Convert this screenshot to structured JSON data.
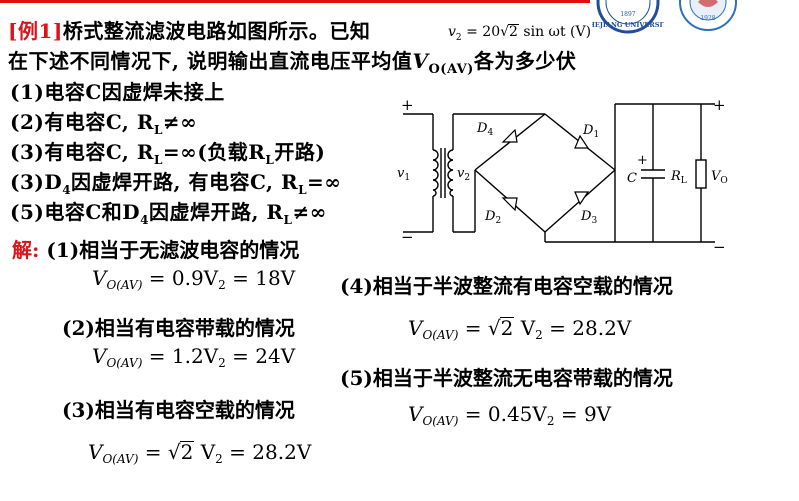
{
  "header": {
    "example_label": "[例1]",
    "title_part1": "桥式整流滤波电路如图所示。已知",
    "given_lhs": "v",
    "given_sub": "2",
    "given_eq": " = 20",
    "given_rad": "2",
    "given_rest": " sin ωt (V)",
    "line2_part1": "在下述不同情况下, 说明输出直流电压平均值",
    "line2_V": "V",
    "line2_sub": "O(AV)",
    "line2_part2": "各为多少伏"
  },
  "logos": {
    "univ_text": "ZHEJIANG UNIVERSITY",
    "univ_year": "1897",
    "second_year": "1928"
  },
  "cases": [
    {
      "num": "(1)",
      "text": "电容C因虚焊未接上"
    },
    {
      "num": "(2)",
      "text": "有电容C, R",
      "sub": "L",
      "tail": "≠∞"
    },
    {
      "num": "(3)",
      "text": "有电容C, R",
      "sub": "L",
      "tail": "=∞(负载R",
      "sub2": "L",
      "tail2": "开路)"
    },
    {
      "num": "(3)",
      "text": "D",
      "sub": "4",
      "tail": "因虚焊开路, 有电容C, R",
      "sub2": "L",
      "tail2": "=∞"
    },
    {
      "num": "(5)",
      "text": "电容C和D",
      "sub": "4",
      "tail": "因虚焊开路, R",
      "sub2": "L",
      "tail2": "≠∞"
    }
  ],
  "solution": {
    "label": "解:",
    "s1_title": "(1)相当于无滤波电容的情况",
    "s1_eq": "= 0.9V",
    "s1_eq_sub": "2",
    "s1_eq_tail": " = 18V",
    "s2_title": "(2)相当有电容带载的情况",
    "s2_eq": "= 1.2V",
    "s2_eq_sub": "2",
    "s2_eq_tail": " = 24V",
    "s3_title": "(3)相当有电容空载的情况",
    "s3_eq_pre": "= ",
    "s3_rad": "2",
    "s3_eq": " V",
    "s3_eq_sub": "2",
    "s3_eq_tail": " = 28.2V",
    "s4_title": "(4)相当于半波整流有电容空载的情况",
    "s4_eq_pre": "= ",
    "s4_rad": "2",
    "s4_eq": " V",
    "s4_eq_sub": "2",
    "s4_eq_tail": " = 28.2V",
    "s5_title": "(5)相当于半波整流无电容带载的情况",
    "s5_eq": "= 0.45V",
    "s5_eq_sub": "2",
    "s5_eq_tail": " = 9V",
    "vo_main": "V",
    "vo_sub": "O(AV)"
  },
  "circuit": {
    "plus": "+",
    "minus": "−",
    "v1": "v",
    "v1_sub": "1",
    "v2": "v",
    "v2_sub": "2",
    "d1": "D",
    "d1_sub": "1",
    "d2": "D",
    "d2_sub": "2",
    "d3": "D",
    "d3_sub": "3",
    "d4": "D",
    "d4_sub": "4",
    "cap": "C",
    "rl": "R",
    "rl_sub": "L",
    "vo": "V",
    "vo_sub": "O"
  },
  "colors": {
    "accent_red": "#d9141a",
    "logo_blue": "#1f4e9c"
  }
}
